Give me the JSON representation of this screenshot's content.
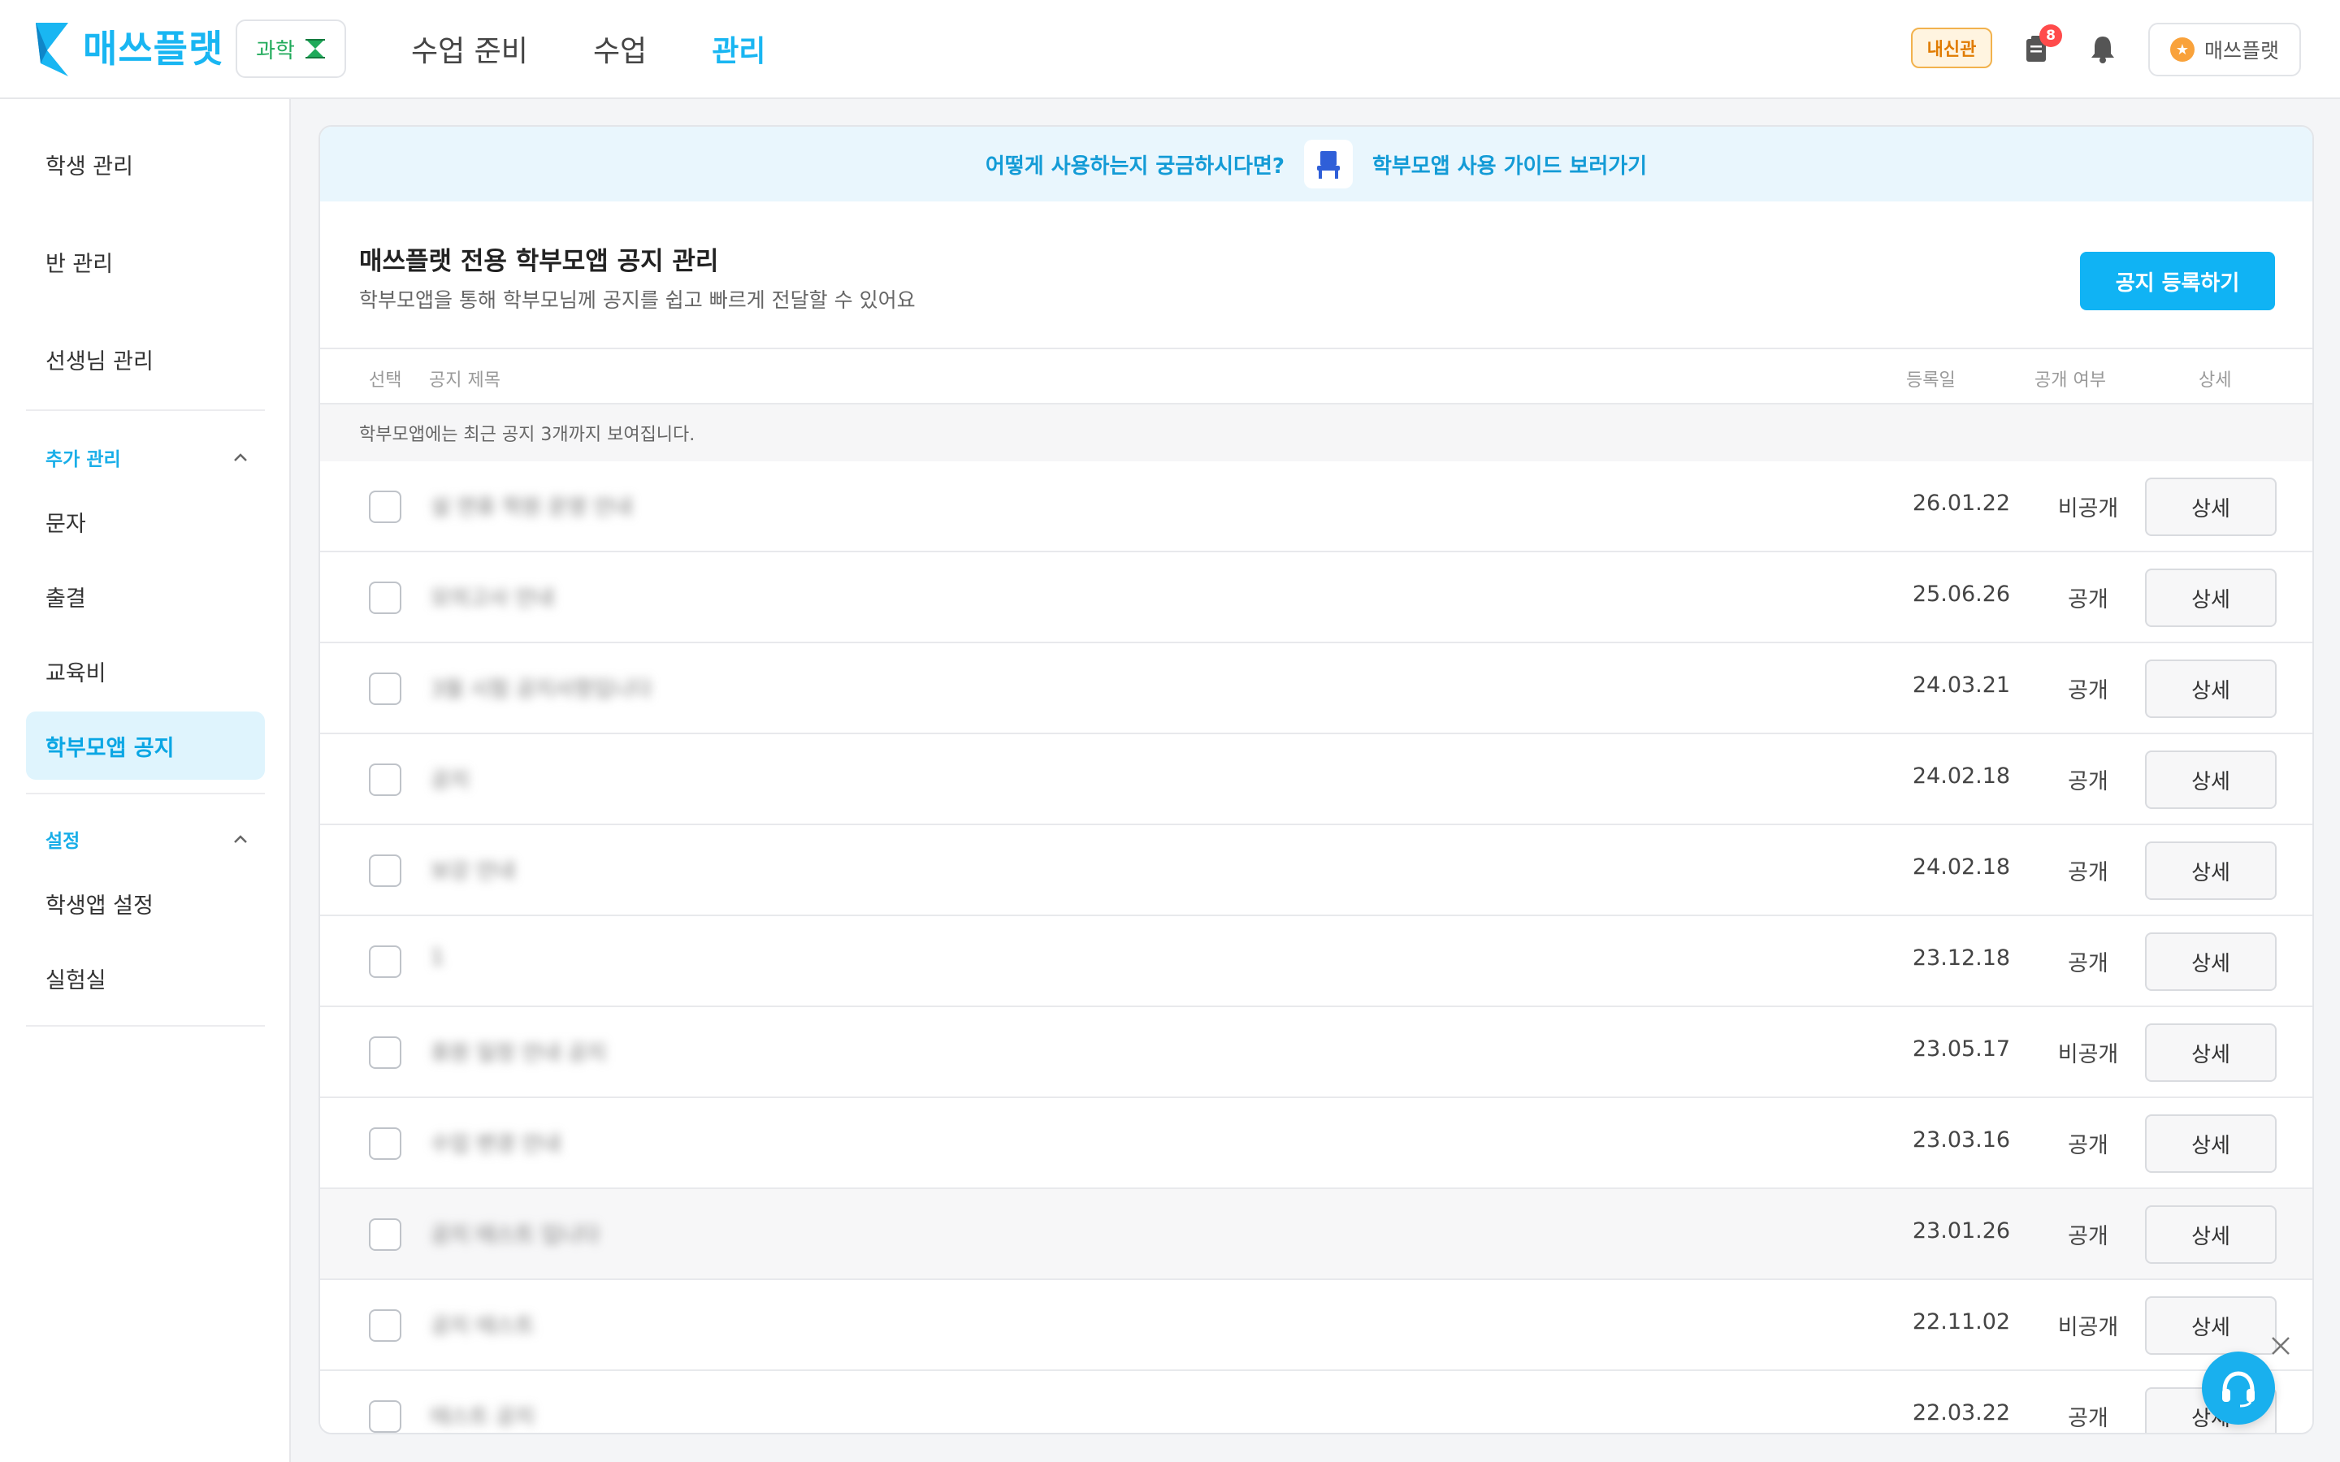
{
  "header": {
    "brand": "매쓰플랫",
    "subject": "과학",
    "nav": [
      "수업 준비",
      "수업",
      "관리"
    ],
    "active_nav": "관리",
    "naesin": "내신관",
    "badge_count": "8",
    "profile": "매쓰플랫"
  },
  "sidebar": {
    "items_top": [
      "학생 관리",
      "반 관리",
      "선생님 관리"
    ],
    "group_extra": "추가 관리",
    "items_extra": [
      "문자",
      "출결",
      "교육비",
      "학부모앱 공지"
    ],
    "active_item": "학부모앱 공지",
    "group_settings": "설정",
    "items_settings": [
      "학생앱 설정",
      "실험실"
    ]
  },
  "guide": {
    "question": "어떻게 사용하는지 궁금하시다면?",
    "link": "학부모앱 사용 가이드 보러가기"
  },
  "page": {
    "title": "매쓰플랫 전용 학부모앱 공지 관리",
    "subtitle": "학부모앱을 통해 학부모님께 공지를 쉽고 빠르게 전달할 수 있어요",
    "register_button": "공지 등록하기"
  },
  "table": {
    "headers": {
      "select": "선택",
      "title": "공지 제목",
      "date": "등록일",
      "public": "공개 여부",
      "detail": "상세"
    },
    "notice": "학부모앱에는 최근 공지 3개까지 보여집니다.",
    "detail_label": "상세",
    "rows": [
      {
        "title": "설 연휴 학원 운영 안내",
        "date": "26.01.22",
        "public": "비공개"
      },
      {
        "title": "모의고사 안내",
        "date": "25.06.26",
        "public": "공개"
      },
      {
        "title": "3월 시험 공지사항입니다",
        "date": "24.03.21",
        "public": "공개"
      },
      {
        "title": "공지",
        "date": "24.02.18",
        "public": "공개"
      },
      {
        "title": "보강 안내",
        "date": "24.02.18",
        "public": "공개"
      },
      {
        "title": "1",
        "date": "23.12.18",
        "public": "공개"
      },
      {
        "title": "휴원 일정 안내 공지",
        "date": "23.05.17",
        "public": "비공개"
      },
      {
        "title": "수업 변경 안내",
        "date": "23.03.16",
        "public": "공개"
      },
      {
        "title": "공지 테스트 입니다",
        "date": "23.01.26",
        "public": "공개"
      },
      {
        "title": "공지 테스트",
        "date": "22.11.02",
        "public": "비공개"
      },
      {
        "title": "테스트 공지",
        "date": "22.03.22",
        "public": "공개"
      }
    ]
  },
  "colors": {
    "accent": "#19b6f2",
    "active_bg": "#dff4fd",
    "badge": "#ff4b4b"
  }
}
